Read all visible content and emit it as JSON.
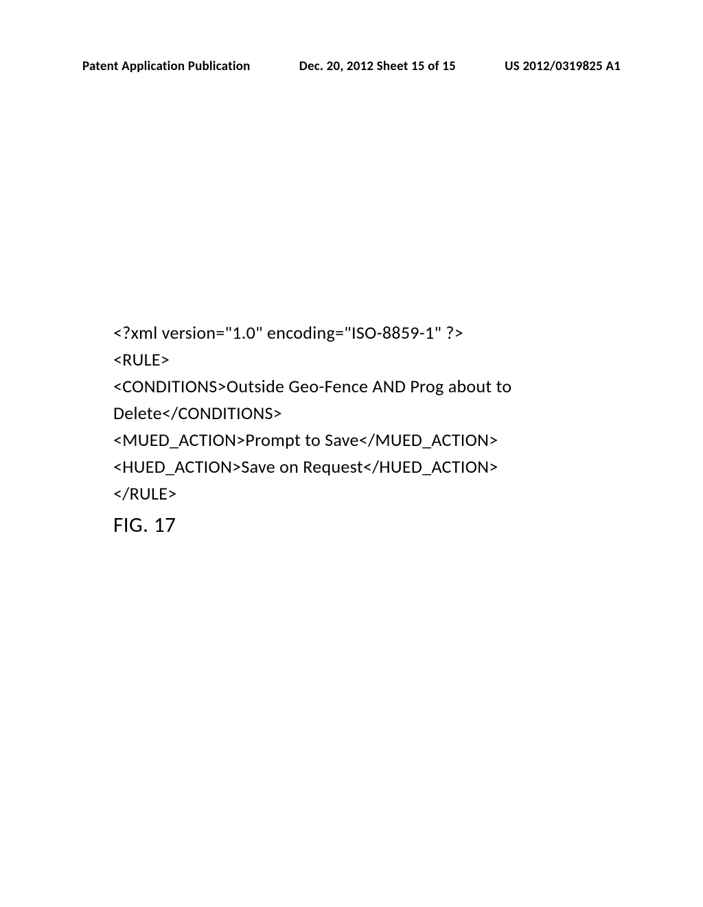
{
  "header": {
    "left": "Patent Application Publication",
    "center": "Dec. 20, 2012  Sheet 15 of 15",
    "right": "US 2012/0319825 A1"
  },
  "xml": {
    "line1": "<?xml version=\"1.0\" encoding=\"ISO-8859-1\" ?>",
    "line2": "<RULE>",
    "line3": "<CONDITIONS>Outside Geo-Fence AND Prog about to",
    "line4": "Delete</CONDITIONS>",
    "line5": "<MUED_ACTION>Prompt to Save</MUED_ACTION>",
    "line6": "<HUED_ACTION>Save on Request</HUED_ACTION>",
    "line7": "</RULE>"
  },
  "figure_label": "FIG. 17"
}
